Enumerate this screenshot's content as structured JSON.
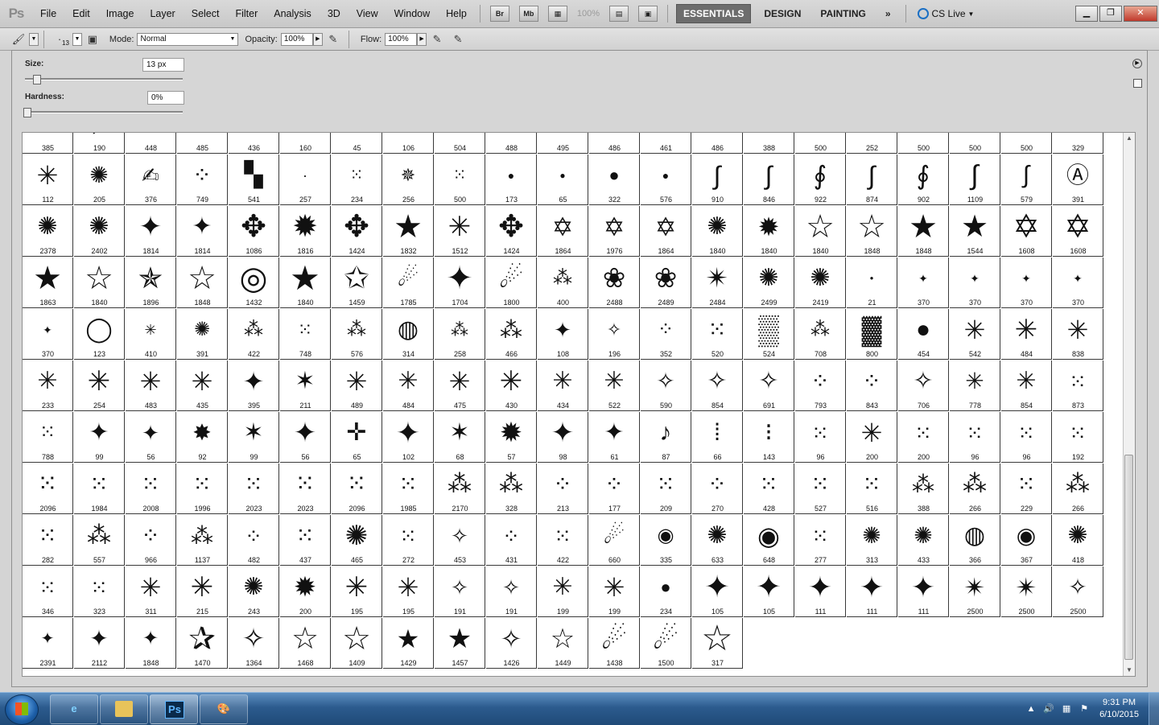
{
  "app": {
    "logo": "Ps"
  },
  "menu": [
    "File",
    "Edit",
    "Image",
    "Layer",
    "Select",
    "Filter",
    "Analysis",
    "3D",
    "View",
    "Window",
    "Help"
  ],
  "menubar_tools": {
    "bridge": "Br",
    "minibridge": "Mb",
    "zoom": "100%"
  },
  "workspaces": {
    "essentials": "ESSENTIALS",
    "design": "DESIGN",
    "painting": "PAINTING",
    "more": "»"
  },
  "cslive": "CS Live",
  "options": {
    "mode_label": "Mode:",
    "mode_value": "Normal",
    "opacity_label": "Opacity:",
    "opacity_value": "100%",
    "flow_label": "Flow:",
    "flow_value": "100%",
    "brush_size_small": "13"
  },
  "picker": {
    "size_label": "Size:",
    "size_value": "13 px",
    "size_fraction": 0.05,
    "hardness_label": "Hardness:",
    "hardness_value": "0%",
    "hardness_fraction": 0.0
  },
  "brushes": [
    {
      "n": "385",
      "g": "★",
      "s": 24
    },
    {
      "n": "190",
      "g": "╱",
      "s": 22
    },
    {
      "n": "448",
      "g": "✦",
      "s": 18
    },
    {
      "n": "485",
      "g": "·",
      "s": 16
    },
    {
      "n": "436",
      "g": "╵",
      "s": 14
    },
    {
      "n": "160",
      "g": "╵",
      "s": 14
    },
    {
      "n": "45",
      "g": "╵",
      "s": 14
    },
    {
      "n": "106",
      "g": "✳",
      "s": 14
    },
    {
      "n": "504",
      "g": "◉",
      "s": 22
    },
    {
      "n": "488",
      "g": "✹",
      "s": 22
    },
    {
      "n": "495",
      "g": "◉",
      "s": 22
    },
    {
      "n": "486",
      "g": "❈",
      "s": 20
    },
    {
      "n": "461",
      "g": "✢",
      "s": 16
    },
    {
      "n": "486",
      "g": "╋",
      "s": 16
    },
    {
      "n": "388",
      "g": "●",
      "s": 12
    },
    {
      "n": "500",
      "g": "●",
      "s": 14
    },
    {
      "n": "252",
      "g": "●",
      "s": 12
    },
    {
      "n": "500",
      "g": "●",
      "s": 14
    },
    {
      "n": "500",
      "g": "●",
      "s": 14
    },
    {
      "n": "500",
      "g": "●",
      "s": 14
    },
    {
      "n": "329",
      "g": "●",
      "s": 12
    },
    {
      "n": "112",
      "g": "✳",
      "s": 32
    },
    {
      "n": "205",
      "g": "✺",
      "s": 28
    },
    {
      "n": "376",
      "g": "✍",
      "s": 26
    },
    {
      "n": "749",
      "g": "⁘",
      "s": 28
    },
    {
      "n": "541",
      "g": "▚",
      "s": 30
    },
    {
      "n": "257",
      "g": "·",
      "s": 18
    },
    {
      "n": "234",
      "g": "⁙",
      "s": 20
    },
    {
      "n": "256",
      "g": "✵",
      "s": 22
    },
    {
      "n": "500",
      "g": "⁙",
      "s": 20
    },
    {
      "n": "173",
      "g": "●",
      "s": 14
    },
    {
      "n": "65",
      "g": "●",
      "s": 12
    },
    {
      "n": "322",
      "g": "●",
      "s": 22
    },
    {
      "n": "576",
      "g": "●",
      "s": 14
    },
    {
      "n": "910",
      "g": "∫",
      "s": 32
    },
    {
      "n": "846",
      "g": "∫",
      "s": 32
    },
    {
      "n": "922",
      "g": "∮",
      "s": 32
    },
    {
      "n": "874",
      "g": "∫",
      "s": 32
    },
    {
      "n": "902",
      "g": "∮",
      "s": 32
    },
    {
      "n": "1109",
      "g": "∫",
      "s": 34
    },
    {
      "n": "579",
      "g": "∫",
      "s": 30
    },
    {
      "n": "391",
      "g": "Ⓐ",
      "s": 28
    },
    {
      "n": "2378",
      "g": "✺",
      "s": 30
    },
    {
      "n": "2402",
      "g": "✺",
      "s": 30
    },
    {
      "n": "1814",
      "g": "✦",
      "s": 34
    },
    {
      "n": "1814",
      "g": "✦",
      "s": 30
    },
    {
      "n": "1086",
      "g": "✥",
      "s": 38
    },
    {
      "n": "1816",
      "g": "✹",
      "s": 38
    },
    {
      "n": "1424",
      "g": "✥",
      "s": 38
    },
    {
      "n": "1832",
      "g": "★",
      "s": 40
    },
    {
      "n": "1512",
      "g": "✳",
      "s": 34
    },
    {
      "n": "1424",
      "g": "✥",
      "s": 38
    },
    {
      "n": "1864",
      "g": "✡",
      "s": 32
    },
    {
      "n": "1976",
      "g": "✡",
      "s": 32
    },
    {
      "n": "1864",
      "g": "✡",
      "s": 32
    },
    {
      "n": "1840",
      "g": "✺",
      "s": 30
    },
    {
      "n": "1840",
      "g": "✹",
      "s": 32
    },
    {
      "n": "1840",
      "g": "☆",
      "s": 40
    },
    {
      "n": "1848",
      "g": "☆",
      "s": 40
    },
    {
      "n": "1848",
      "g": "★",
      "s": 40
    },
    {
      "n": "1544",
      "g": "★",
      "s": 38
    },
    {
      "n": "1608",
      "g": "✡",
      "s": 40
    },
    {
      "n": "1608",
      "g": "✡",
      "s": 40
    },
    {
      "n": "1863",
      "g": "★",
      "s": 40
    },
    {
      "n": "1840",
      "g": "☆",
      "s": 40
    },
    {
      "n": "1896",
      "g": "✯",
      "s": 36
    },
    {
      "n": "1848",
      "g": "☆",
      "s": 40
    },
    {
      "n": "1432",
      "g": "◎",
      "s": 40
    },
    {
      "n": "1840",
      "g": "★",
      "s": 42
    },
    {
      "n": "1459",
      "g": "✩",
      "s": 38
    },
    {
      "n": "1785",
      "g": "☄",
      "s": 30
    },
    {
      "n": "1704",
      "g": "✦",
      "s": 40
    },
    {
      "n": "1800",
      "g": "☄",
      "s": 34
    },
    {
      "n": "400",
      "g": "⁂",
      "s": 24
    },
    {
      "n": "2488",
      "g": "❀",
      "s": 34
    },
    {
      "n": "2489",
      "g": "❀",
      "s": 34
    },
    {
      "n": "2484",
      "g": "✴",
      "s": 34
    },
    {
      "n": "2499",
      "g": "✺",
      "s": 30
    },
    {
      "n": "2419",
      "g": "✺",
      "s": 30
    },
    {
      "n": "21",
      "g": "●",
      "s": 8
    },
    {
      "n": "370",
      "g": "✦",
      "s": 14
    },
    {
      "n": "370",
      "g": "✦",
      "s": 14
    },
    {
      "n": "370",
      "g": "✦",
      "s": 14
    },
    {
      "n": "370",
      "g": "✦",
      "s": 14
    },
    {
      "n": "370",
      "g": "✦",
      "s": 14
    },
    {
      "n": "123",
      "g": "◯",
      "s": 30
    },
    {
      "n": "410",
      "g": "✳",
      "s": 18
    },
    {
      "n": "391",
      "g": "✺",
      "s": 24
    },
    {
      "n": "422",
      "g": "⁂",
      "s": 24
    },
    {
      "n": "748",
      "g": "⁙",
      "s": 22
    },
    {
      "n": "576",
      "g": "⁂",
      "s": 24
    },
    {
      "n": "314",
      "g": "◍",
      "s": 30
    },
    {
      "n": "258",
      "g": "⁂",
      "s": 22
    },
    {
      "n": "466",
      "g": "⁂",
      "s": 28
    },
    {
      "n": "108",
      "g": "✦",
      "s": 26
    },
    {
      "n": "196",
      "g": "✧",
      "s": 22
    },
    {
      "n": "352",
      "g": "⁘",
      "s": 24
    },
    {
      "n": "520",
      "g": "⁙",
      "s": 28
    },
    {
      "n": "524",
      "g": "▒",
      "s": 36
    },
    {
      "n": "708",
      "g": "⁂",
      "s": 24
    },
    {
      "n": "800",
      "g": "▓",
      "s": 34
    },
    {
      "n": "454",
      "g": "●",
      "s": 30
    },
    {
      "n": "542",
      "g": "✳",
      "s": 32
    },
    {
      "n": "484",
      "g": "✳",
      "s": 34
    },
    {
      "n": "838",
      "g": "✳",
      "s": 32
    },
    {
      "n": "233",
      "g": "✳",
      "s": 30
    },
    {
      "n": "254",
      "g": "✳",
      "s": 34
    },
    {
      "n": "483",
      "g": "✳",
      "s": 32
    },
    {
      "n": "435",
      "g": "✳",
      "s": 32
    },
    {
      "n": "395",
      "g": "✦",
      "s": 32
    },
    {
      "n": "211",
      "g": "✶",
      "s": 30
    },
    {
      "n": "489",
      "g": "✳",
      "s": 32
    },
    {
      "n": "484",
      "g": "✳",
      "s": 30
    },
    {
      "n": "475",
      "g": "✳",
      "s": 32
    },
    {
      "n": "430",
      "g": "✳",
      "s": 34
    },
    {
      "n": "434",
      "g": "✳",
      "s": 30
    },
    {
      "n": "522",
      "g": "✳",
      "s": 30
    },
    {
      "n": "590",
      "g": "✧",
      "s": 28
    },
    {
      "n": "854",
      "g": "✧",
      "s": 30
    },
    {
      "n": "691",
      "g": "✧",
      "s": 30
    },
    {
      "n": "793",
      "g": "⁘",
      "s": 28
    },
    {
      "n": "843",
      "g": "⁘",
      "s": 28
    },
    {
      "n": "706",
      "g": "✧",
      "s": 30
    },
    {
      "n": "778",
      "g": "✳",
      "s": 28
    },
    {
      "n": "854",
      "g": "✳",
      "s": 30
    },
    {
      "n": "873",
      "g": "⁙",
      "s": 26
    },
    {
      "n": "788",
      "g": "⁙",
      "s": 24
    },
    {
      "n": "99",
      "g": "✦",
      "s": 30
    },
    {
      "n": "56",
      "g": "✦",
      "s": 26
    },
    {
      "n": "92",
      "g": "✸",
      "s": 28
    },
    {
      "n": "99",
      "g": "✶",
      "s": 30
    },
    {
      "n": "56",
      "g": "✦",
      "s": 34
    },
    {
      "n": "65",
      "g": "✛",
      "s": 30
    },
    {
      "n": "102",
      "g": "✦",
      "s": 36
    },
    {
      "n": "68",
      "g": "✶",
      "s": 30
    },
    {
      "n": "57",
      "g": "✹",
      "s": 34
    },
    {
      "n": "98",
      "g": "✦",
      "s": 34
    },
    {
      "n": "61",
      "g": "✦",
      "s": 30
    },
    {
      "n": "87",
      "g": "♪",
      "s": 30
    },
    {
      "n": "66",
      "g": "⁞",
      "s": 30
    },
    {
      "n": "143",
      "g": "⁝",
      "s": 30
    },
    {
      "n": "96",
      "g": "⁙",
      "s": 26
    },
    {
      "n": "200",
      "g": "✳",
      "s": 32
    },
    {
      "n": "200",
      "g": "⁙",
      "s": 26
    },
    {
      "n": "96",
      "g": "⁙",
      "s": 26
    },
    {
      "n": "96",
      "g": "⁙",
      "s": 26
    },
    {
      "n": "192",
      "g": "⁙",
      "s": 26
    },
    {
      "n": "2096",
      "g": "⁙",
      "s": 30
    },
    {
      "n": "1984",
      "g": "⁙",
      "s": 28
    },
    {
      "n": "2008",
      "g": "⁙",
      "s": 28
    },
    {
      "n": "1996",
      "g": "⁙",
      "s": 28
    },
    {
      "n": "2023",
      "g": "⁙",
      "s": 28
    },
    {
      "n": "2023",
      "g": "⁙",
      "s": 30
    },
    {
      "n": "2096",
      "g": "⁙",
      "s": 30
    },
    {
      "n": "1985",
      "g": "⁙",
      "s": 28
    },
    {
      "n": "2170",
      "g": "⁂",
      "s": 30
    },
    {
      "n": "328",
      "g": "⁂",
      "s": 30
    },
    {
      "n": "213",
      "g": "⁘",
      "s": 28
    },
    {
      "n": "177",
      "g": "⁘",
      "s": 28
    },
    {
      "n": "209",
      "g": "⁙",
      "s": 28
    },
    {
      "n": "270",
      "g": "⁘",
      "s": 28
    },
    {
      "n": "428",
      "g": "⁙",
      "s": 28
    },
    {
      "n": "527",
      "g": "⁙",
      "s": 28
    },
    {
      "n": "516",
      "g": "⁙",
      "s": 28
    },
    {
      "n": "388",
      "g": "⁂",
      "s": 28
    },
    {
      "n": "266",
      "g": "⁂",
      "s": 30
    },
    {
      "n": "229",
      "g": "⁙",
      "s": 28
    },
    {
      "n": "266",
      "g": "⁂",
      "s": 30
    },
    {
      "n": "282",
      "g": "⁙",
      "s": 28
    },
    {
      "n": "557",
      "g": "⁂",
      "s": 30
    },
    {
      "n": "966",
      "g": "⁘",
      "s": 28
    },
    {
      "n": "1137",
      "g": "⁂",
      "s": 28
    },
    {
      "n": "482",
      "g": "⁘",
      "s": 26
    },
    {
      "n": "437",
      "g": "⁙",
      "s": 28
    },
    {
      "n": "465",
      "g": "✺",
      "s": 34
    },
    {
      "n": "272",
      "g": "⁙",
      "s": 26
    },
    {
      "n": "453",
      "g": "✧",
      "s": 26
    },
    {
      "n": "431",
      "g": "⁘",
      "s": 26
    },
    {
      "n": "422",
      "g": "⁙",
      "s": 26
    },
    {
      "n": "660",
      "g": "☄",
      "s": 30
    },
    {
      "n": "335",
      "g": "◉",
      "s": 24
    },
    {
      "n": "633",
      "g": "✺",
      "s": 30
    },
    {
      "n": "648",
      "g": "◉",
      "s": 32
    },
    {
      "n": "277",
      "g": "⁙",
      "s": 26
    },
    {
      "n": "313",
      "g": "✺",
      "s": 28
    },
    {
      "n": "433",
      "g": "✺",
      "s": 28
    },
    {
      "n": "366",
      "g": "◍",
      "s": 30
    },
    {
      "n": "367",
      "g": "◉",
      "s": 28
    },
    {
      "n": "418",
      "g": "✺",
      "s": 30
    },
    {
      "n": "346",
      "g": "⁙",
      "s": 26
    },
    {
      "n": "323",
      "g": "⁙",
      "s": 26
    },
    {
      "n": "311",
      "g": "✳",
      "s": 32
    },
    {
      "n": "215",
      "g": "✳",
      "s": 34
    },
    {
      "n": "243",
      "g": "✺",
      "s": 30
    },
    {
      "n": "200",
      "g": "✹",
      "s": 34
    },
    {
      "n": "195",
      "g": "✳",
      "s": 34
    },
    {
      "n": "195",
      "g": "✳",
      "s": 32
    },
    {
      "n": "191",
      "g": "✧",
      "s": 26
    },
    {
      "n": "191",
      "g": "✧",
      "s": 26
    },
    {
      "n": "199",
      "g": "✳",
      "s": 30
    },
    {
      "n": "199",
      "g": "✳",
      "s": 32
    },
    {
      "n": "234",
      "g": "●",
      "s": 22
    },
    {
      "n": "105",
      "g": "✦",
      "s": 38
    },
    {
      "n": "105",
      "g": "✦",
      "s": 38
    },
    {
      "n": "111",
      "g": "✦",
      "s": 36
    },
    {
      "n": "111",
      "g": "✦",
      "s": 36
    },
    {
      "n": "111",
      "g": "✦",
      "s": 36
    },
    {
      "n": "2500",
      "g": "✴",
      "s": 32
    },
    {
      "n": "2500",
      "g": "✴",
      "s": 32
    },
    {
      "n": "2500",
      "g": "✧",
      "s": 28
    },
    {
      "n": "2391",
      "g": "✦",
      "s": 20
    },
    {
      "n": "2112",
      "g": "✦",
      "s": 28
    },
    {
      "n": "1848",
      "g": "✦",
      "s": 24
    },
    {
      "n": "1470",
      "g": "✰",
      "s": 40
    },
    {
      "n": "1364",
      "g": "✧",
      "s": 34
    },
    {
      "n": "1468",
      "g": "☆",
      "s": 38
    },
    {
      "n": "1409",
      "g": "☆",
      "s": 40
    },
    {
      "n": "1429",
      "g": "★",
      "s": 32
    },
    {
      "n": "1457",
      "g": "★",
      "s": 34
    },
    {
      "n": "1426",
      "g": "✧",
      "s": 32
    },
    {
      "n": "1449",
      "g": "☆",
      "s": 34
    },
    {
      "n": "1438",
      "g": "☄",
      "s": 36
    },
    {
      "n": "1500",
      "g": "☄",
      "s": 36
    },
    {
      "n": "317",
      "g": "☆",
      "s": 44
    }
  ],
  "taskbar": {
    "photoshop": "Ps"
  },
  "clock": {
    "time": "9:31 PM",
    "date": "6/10/2015"
  }
}
